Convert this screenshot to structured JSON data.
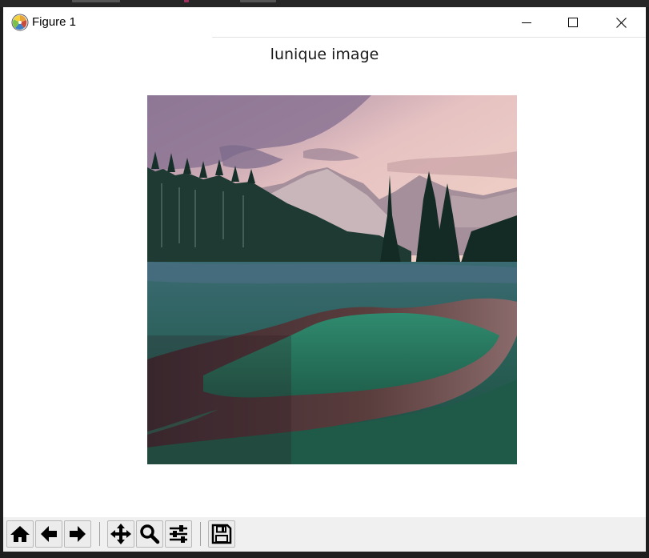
{
  "window": {
    "title": "Figure 1",
    "app_icon": "matplotlib-icon"
  },
  "window_controls": {
    "minimize_icon": "minimize-icon",
    "maximize_icon": "maximize-icon",
    "close_icon": "close-icon"
  },
  "figure": {
    "axes_title": "lunique image",
    "image_content": "landscape-photo"
  },
  "toolbar": {
    "buttons": [
      {
        "name": "home-button",
        "icon": "home-icon"
      },
      {
        "name": "back-button",
        "icon": "arrow-left-icon"
      },
      {
        "name": "forward-button",
        "icon": "arrow-right-icon"
      },
      {
        "name": "pan-button",
        "icon": "move-icon"
      },
      {
        "name": "zoom-button",
        "icon": "magnifier-icon"
      },
      {
        "name": "configure-subplots-button",
        "icon": "sliders-icon"
      },
      {
        "name": "save-button",
        "icon": "floppy-disk-icon"
      }
    ]
  },
  "colors": {
    "window_bg": "#ffffff",
    "toolbar_bg": "#f0f0f0",
    "desktop_bg": "#1e1e1e"
  }
}
